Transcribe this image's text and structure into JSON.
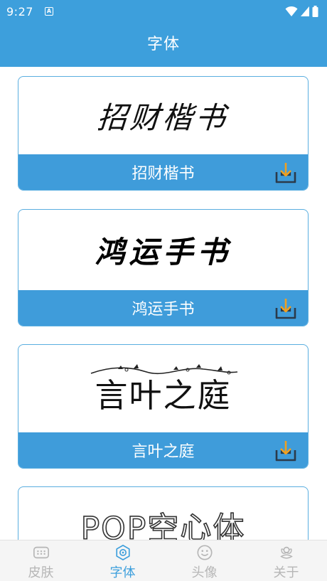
{
  "status": {
    "time": "9:27",
    "app_icon": "A"
  },
  "header": {
    "title": "字体"
  },
  "fonts": [
    {
      "preview": "招财楷书",
      "name": "招财楷书",
      "icon": "download-icon"
    },
    {
      "preview": "鸿运手书",
      "name": "鸿运手书",
      "icon": "download-icon"
    },
    {
      "preview": "言叶之庭",
      "name": "言叶之庭",
      "icon": "download-icon"
    },
    {
      "preview": "POP空心体",
      "name": "",
      "icon": "download-icon"
    }
  ],
  "nav": {
    "items": [
      {
        "label": "皮肤",
        "icon": "skin-icon",
        "active": false
      },
      {
        "label": "字体",
        "icon": "font-icon",
        "active": true
      },
      {
        "label": "头像",
        "icon": "smiley-icon",
        "active": false
      },
      {
        "label": "关于",
        "icon": "flower-icon",
        "active": false
      }
    ]
  },
  "colors": {
    "primary": "#3d9fdc",
    "download_accent": "#f0a020",
    "inactive": "#b6b6b6"
  }
}
